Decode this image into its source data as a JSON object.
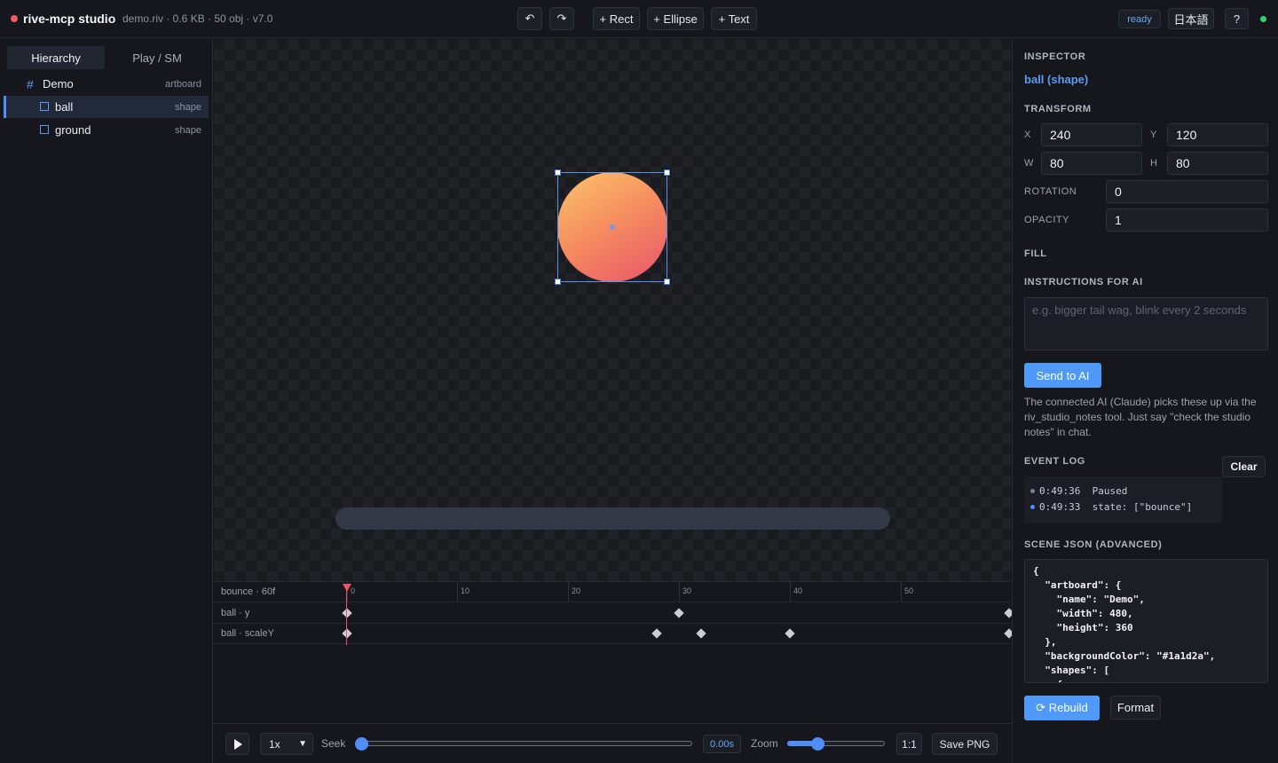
{
  "topbar": {
    "app_name": "rive-mcp studio",
    "doc_meta": "demo.riv · 0.6 KB · 50 obj · v7.0",
    "undo_icon": "↶",
    "redo_icon": "↷",
    "add_rect": "+ Rect",
    "add_ellipse": "+ Ellipse",
    "add_text": "+ Text",
    "status": "ready",
    "language": "日本語",
    "help": "?",
    "colors": {
      "brand_dot": "#ef5b63",
      "connected_dot": "#38d26b",
      "accent": "#4f8ef7"
    }
  },
  "left_panel": {
    "tabs": [
      {
        "label": "Hierarchy"
      },
      {
        "label": "Play / SM"
      }
    ],
    "tree": [
      {
        "name": "Demo",
        "kind": "artboard",
        "icon": "hash-icon"
      },
      {
        "name": "ball",
        "kind": "shape",
        "icon": "square-icon"
      },
      {
        "name": "ground",
        "kind": "shape",
        "icon": "square-icon"
      }
    ]
  },
  "timeline": {
    "animation": "bounce · 60f",
    "ruler": [
      "0",
      "10",
      "20",
      "30",
      "40",
      "50"
    ],
    "tracks": [
      {
        "label": "ball · y"
      },
      {
        "label": "ball · scaleY"
      }
    ]
  },
  "transport": {
    "speed": "1x",
    "seek_label": "Seek",
    "seek_time": "0.00s",
    "zoom_label": "Zoom",
    "fit": "1:1",
    "save_png": "Save PNG"
  },
  "inspector": {
    "title": "INSPECTOR",
    "selection": "ball (shape)",
    "transform_title": "TRANSFORM",
    "x_label": "X",
    "x": "240",
    "y_label": "Y",
    "y": "120",
    "w_label": "W",
    "w": "80",
    "h_label": "H",
    "h": "80",
    "rotation_label": "ROTATION",
    "rotation": "0",
    "opacity_label": "OPACITY",
    "opacity": "1",
    "fill_title": "FILL",
    "instructions_title": "INSTRUCTIONS FOR AI",
    "instructions_placeholder": "e.g. bigger tail wag, blink every 2 seconds",
    "send_ai": "Send to AI",
    "ai_note": "The connected AI (Claude) picks these up via the riv_studio_notes tool. Just say \"check the studio notes\" in chat.",
    "event_log_title": "EVENT LOG",
    "clear": "Clear",
    "event_log": [
      {
        "time": "0:49:36",
        "text": "Paused",
        "dot": "#7b8190"
      },
      {
        "time": "0:49:33",
        "text": "state: [\"bounce\"]",
        "dot": "#4f8ef7"
      }
    ],
    "scene_json_title": "SCENE JSON (ADVANCED)",
    "scene_json": "{\n  \"artboard\": {\n    \"name\": \"Demo\",\n    \"width\": 480,\n    \"height\": 360\n  },\n  \"backgroundColor\": \"#1a1d2a\",\n  \"shapes\": [\n    {",
    "rebuild": "⟳ Rebuild",
    "format": "Format"
  }
}
